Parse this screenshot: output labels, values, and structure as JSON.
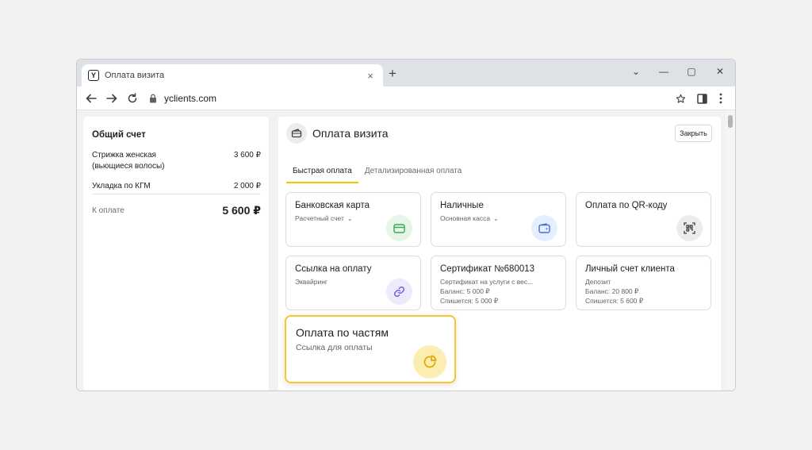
{
  "browser": {
    "tab_title": "Оплата визита",
    "favicon_letter": "Y",
    "tab_close": "×",
    "new_tab": "+",
    "url": "yclients.com",
    "window_controls": [
      "⌄",
      "—",
      "▢",
      "✕"
    ]
  },
  "left_panel": {
    "title": "Общий счет",
    "items": [
      {
        "name": "Стрижка женская\n(вьющиеся волосы)",
        "amount": "3 600 ₽"
      },
      {
        "name": "Укладка по КГМ",
        "amount": "2 000 ₽"
      }
    ],
    "total_label": "К оплате",
    "total_value": "5 600 ₽"
  },
  "right_panel": {
    "title": "Оплата визита",
    "close_label": "Закрыть",
    "tabs": [
      {
        "label": "Быстрая оплата",
        "active": true
      },
      {
        "label": "Детализированная оплата",
        "active": false
      }
    ],
    "cards": [
      {
        "title": "Банковская карта",
        "sub": "Расчетный счет",
        "dropdown": true,
        "icon": "credit-card-icon",
        "icon_bg": "#e5f5e7",
        "icon_color": "#3aa655"
      },
      {
        "title": "Наличные",
        "sub": "Основная касса",
        "dropdown": true,
        "icon": "wallet-icon",
        "icon_bg": "#e6efff",
        "icon_color": "#3f6fdc"
      },
      {
        "title": "Оплата по QR-коду",
        "icon": "qr-scan-icon",
        "icon_bg": "#ececec",
        "icon_color": "#3c4043"
      },
      {
        "title": "Ссылка на оплату",
        "sub": "Эквайринг",
        "icon": "link-icon",
        "icon_bg": "#eeeafd",
        "icon_color": "#7a5ce0"
      },
      {
        "title": "Сертификат №680013",
        "lines": [
          "Сертификат на услуги с вес...",
          "Баланс: 5 000 ₽",
          "Спишется: 5 000 ₽"
        ]
      },
      {
        "title": "Личный счет клиента",
        "lines": [
          "Депозит",
          "Баланс: 20 800 ₽",
          "Спишется: 5 600 ₽"
        ]
      }
    ],
    "highlight_card": {
      "title": "Оплата по частям",
      "sub": "Ссылка для оплаты",
      "icon": "pie-chart-icon",
      "icon_bg": "#fbeeb0",
      "icon_color": "#e0a800"
    }
  },
  "colors": {
    "accent_yellow": "#f6c500",
    "highlight_border": "#f4c72c"
  }
}
